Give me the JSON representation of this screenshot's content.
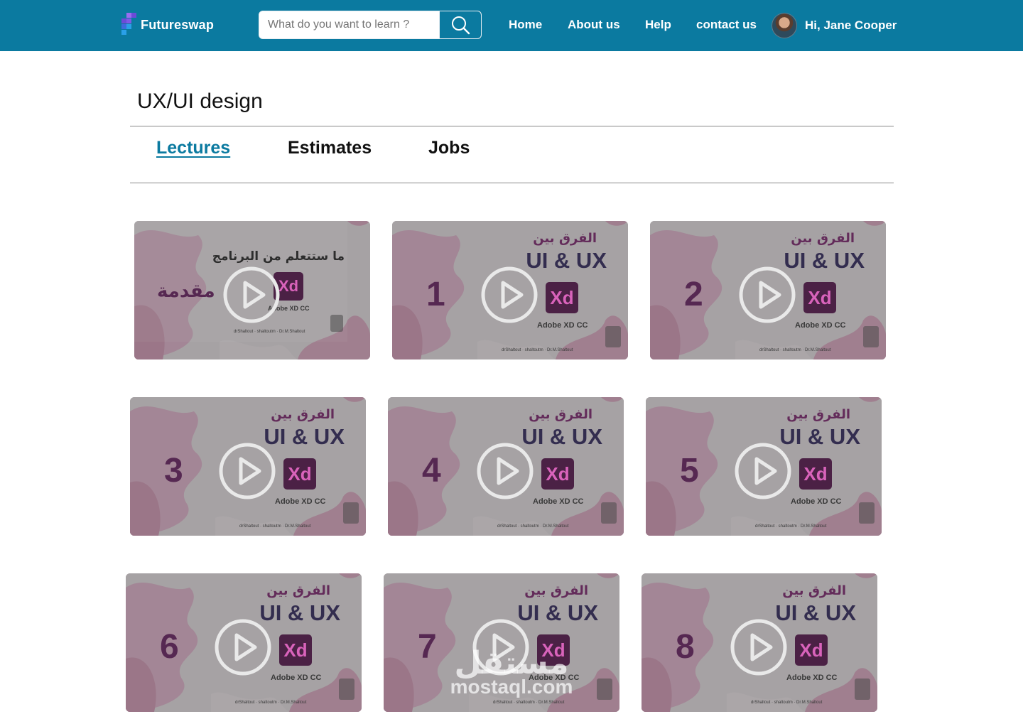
{
  "header": {
    "brand": "Futureswap",
    "search_placeholder": "What do you want to learn ?",
    "nav": [
      "Home",
      "About us",
      "Help",
      "contact us"
    ],
    "greeting": "Hi, Jane Cooper",
    "colors": {
      "bar": "#0b7aa0",
      "logo_mark": [
        "#6b4bd8",
        "#9a6cf0",
        "#3d6bdc",
        "#2aa0e8"
      ]
    }
  },
  "page": {
    "title": "UX/UI design",
    "tabs": [
      {
        "label": "Lectures",
        "active": true
      },
      {
        "label": "Estimates",
        "active": false
      },
      {
        "label": "Jobs",
        "active": false
      }
    ]
  },
  "intro_card": {
    "title_ar": "ما ستتعلم من البرنامج",
    "label_ar": "مقدمة",
    "xd_text": "Xd",
    "xd_label": "Adobe XD CC",
    "socials": "drShaltout · shaltoutm · Dr.M.Shaltout"
  },
  "lesson_template": {
    "title_ar": "الفرق بين",
    "title_en": "UI & UX",
    "xd_text": "Xd",
    "xd_label": "Adobe XD CC",
    "socials": "drShaltout · shaltoutm · Dr.M.Shaltout"
  },
  "lessons": [
    {
      "number": "1"
    },
    {
      "number": "2"
    },
    {
      "number": "3"
    },
    {
      "number": "4"
    },
    {
      "number": "5"
    },
    {
      "number": "6"
    },
    {
      "number": "7"
    },
    {
      "number": "8"
    }
  ],
  "watermark": {
    "ar": "مستقل",
    "en": "mostaql.com"
  }
}
